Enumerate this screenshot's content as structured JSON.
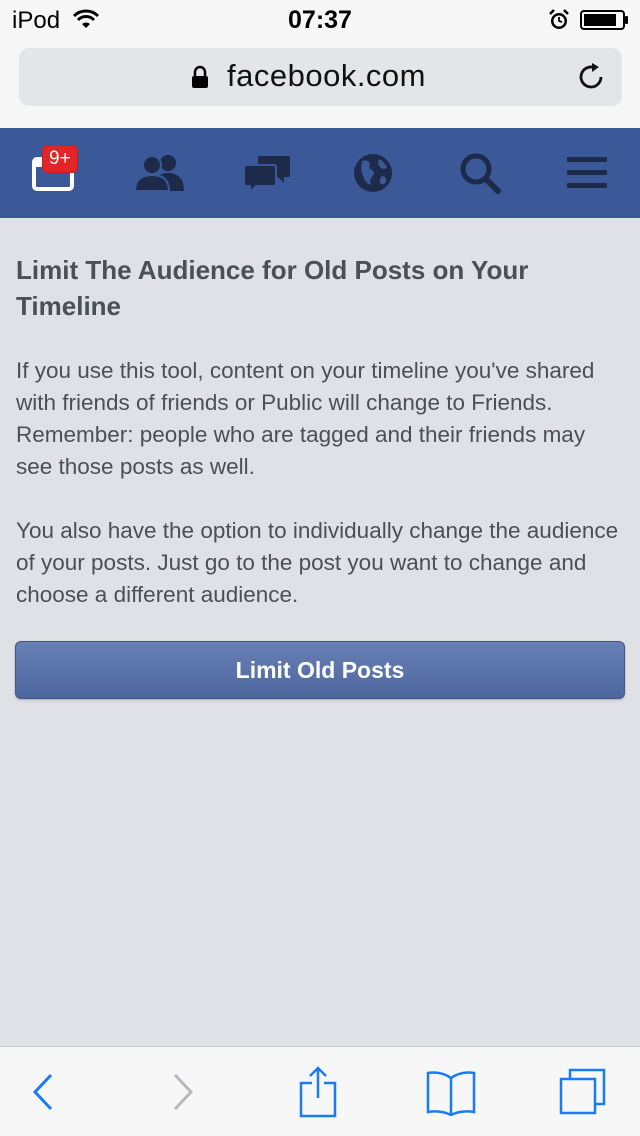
{
  "status_bar": {
    "carrier": "iPod",
    "time": "07:37"
  },
  "browser": {
    "url": "facebook.com"
  },
  "fb_nav": {
    "notification_badge": "9+",
    "items": [
      "notifications-icon",
      "friends-icon",
      "messages-icon",
      "globe-icon",
      "search-icon",
      "menu-icon"
    ]
  },
  "content": {
    "title": "Limit The Audience for Old Posts on Your Timeline",
    "paragraph_1": "If you use this tool, content on your timeline you've shared with friends of friends or Public will change to Friends. Remember: people who are tagged and their friends may see those posts as well.",
    "paragraph_2": "You also have the option to individually change the audience of your posts. Just go to the post you want to change and choose a different audience.",
    "button_label": "Limit Old Posts"
  },
  "toolbar": {
    "items": [
      "back-icon",
      "forward-icon",
      "share-icon",
      "bookmarks-icon",
      "tabs-icon"
    ]
  },
  "colors": {
    "fb_blue": "#3b5998",
    "badge_red": "#e02629",
    "ios_blue": "#1a7cf5",
    "background": "#dfe1e6"
  }
}
